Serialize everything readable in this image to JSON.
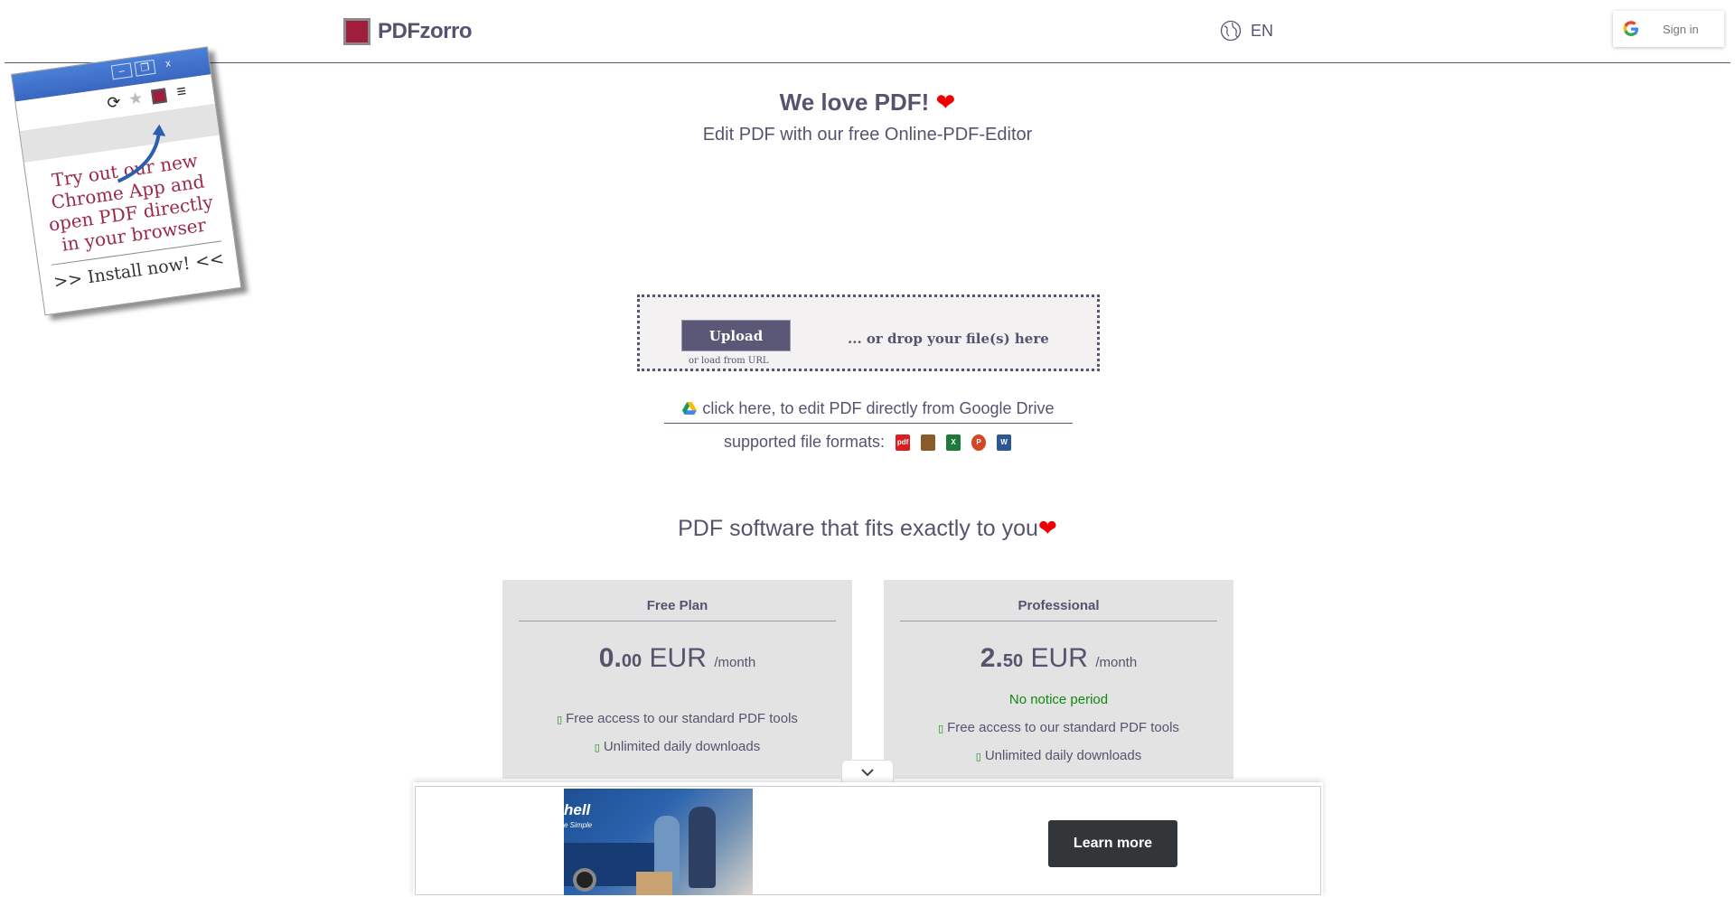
{
  "header": {
    "logo_text": "PDFzorro",
    "language": "EN",
    "signin_label": "Sign in"
  },
  "promo": {
    "line1": "Try out our new",
    "line2": "Chrome App and",
    "line3": "open PDF directly",
    "line4": "in your browser",
    "install": ">> Install now! <<"
  },
  "hero": {
    "title": "We love PDF!",
    "subtitle": "Edit PDF with our free Online-PDF-Editor"
  },
  "upload": {
    "button_label": "Upload",
    "url_link": "or load from URL",
    "drop_text": "... or drop your file(s) here"
  },
  "gdrive": {
    "text": "click here, to edit PDF directly from Google Drive"
  },
  "formats": {
    "label": "supported file formats:",
    "icons": [
      {
        "name": "pdf-icon",
        "color": "#d81e1e",
        "text": "pdf"
      },
      {
        "name": "image-icon",
        "color": "#8a5a2a",
        "text": ""
      },
      {
        "name": "excel-icon",
        "color": "#1d7a3a",
        "text": "X"
      },
      {
        "name": "powerpoint-icon",
        "color": "#d24726",
        "text": "P"
      },
      {
        "name": "word-icon",
        "color": "#2b5797",
        "text": "W"
      }
    ]
  },
  "section": {
    "title": "PDF software that fits exactly to you"
  },
  "plans": [
    {
      "name": "Free Plan",
      "price_int": "0.",
      "price_dec": "00",
      "currency": "EUR",
      "period": "/month",
      "notice": "",
      "features": [
        "Free access to our standard PDF tools",
        "Unlimited daily downloads"
      ]
    },
    {
      "name": "Professional",
      "price_int": "2.",
      "price_dec": "50",
      "currency": "EUR",
      "period": "/month",
      "notice": "No notice period",
      "features": [
        "Free access to our standard PDF tools",
        "Unlimited daily downloads"
      ]
    }
  ],
  "ad": {
    "brand_text": "hell",
    "tagline": "e Simple",
    "cta": "Learn more"
  },
  "colors": {
    "primary": "#55546f",
    "brand": "#a01e3c",
    "heart": "#ee0000",
    "success": "#108a10"
  }
}
